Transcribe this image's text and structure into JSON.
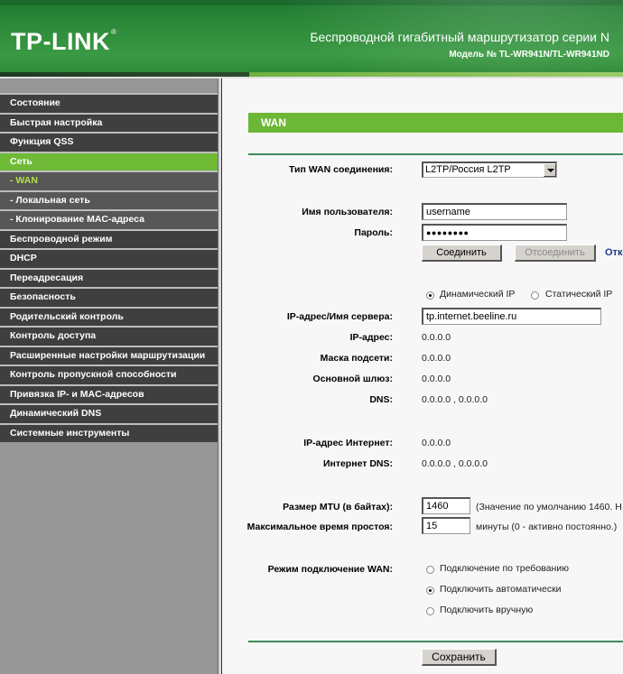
{
  "header": {
    "logo": "TP-LINK",
    "logo_mark": "®",
    "product": "Беспроводной гигабитный маршрутизатор серии N",
    "model": "Модель № TL-WR941N/TL-WR941ND"
  },
  "colors": {
    "brand_green": "#6db736",
    "header_green": "#2e8b3a",
    "menu_bg": "#3f3f3f",
    "submenu_bg": "#575757",
    "submenu_current_text": "#b6e04a"
  },
  "sidebar": {
    "items": [
      {
        "label": "Состояние"
      },
      {
        "label": "Быстрая настройка"
      },
      {
        "label": "Функция QSS"
      },
      {
        "label": "Сеть"
      },
      {
        "label": "- WAN"
      },
      {
        "label": "- Локальная сеть"
      },
      {
        "label": "- Клонирование MAC-адреса"
      },
      {
        "label": "Беспроводной режим"
      },
      {
        "label": "DHCP"
      },
      {
        "label": "Переадресация"
      },
      {
        "label": "Безопасность"
      },
      {
        "label": "Родительский контроль"
      },
      {
        "label": "Контроль доступа"
      },
      {
        "label": "Расширенные настройки маршрутизации"
      },
      {
        "label": "Контроль пропускной способности"
      },
      {
        "label": "Привязка IP- и MAC-адресов"
      },
      {
        "label": "Динамический DNS"
      },
      {
        "label": "Системные инструменты"
      }
    ]
  },
  "main": {
    "title": "WAN",
    "wan_type": {
      "label": "Тип WAN соединения:",
      "value": "L2TP/Россия L2TP"
    },
    "username": {
      "label": "Имя пользователя:",
      "value": "username"
    },
    "password": {
      "label": "Пароль:",
      "value": "●●●●●●●●"
    },
    "connect_button": "Соединить",
    "disconnect_button": "Отсоединить",
    "status_link": "Отк",
    "ip_mode": {
      "dynamic": "Динамический IP",
      "static": "Статический IP",
      "selected": "dynamic"
    },
    "server": {
      "label": "IP-адрес/Имя сервера:",
      "value": "tp.internet.beeline.ru"
    },
    "ip": {
      "label": "IP-адрес:",
      "value": "0.0.0.0"
    },
    "mask": {
      "label": "Маска подсети:",
      "value": "0.0.0.0"
    },
    "gateway": {
      "label": "Основной шлюз:",
      "value": "0.0.0.0"
    },
    "dns": {
      "label": "DNS:",
      "value": "0.0.0.0 , 0.0.0.0"
    },
    "internet_ip": {
      "label": "IP-адрес Интернет:",
      "value": "0.0.0.0"
    },
    "internet_dns": {
      "label": "Интернет DNS:",
      "value": "0.0.0.0 , 0.0.0.0"
    },
    "mtu": {
      "label": "Размер MTU (в байтах):",
      "value": "1460",
      "hint": "(Значение по умолчанию 1460. Н"
    },
    "idle": {
      "label": "Максимальное время простоя:",
      "value": "15",
      "hint": "минуты (0 - активно постоянно.)"
    },
    "wan_mode": {
      "label": "Режим подключение WAN:",
      "options": [
        "Подключение по требованию",
        "Подключить автоматически",
        "Подключить вручную"
      ],
      "selected_index": 1
    },
    "save_button": "Сохранить"
  }
}
